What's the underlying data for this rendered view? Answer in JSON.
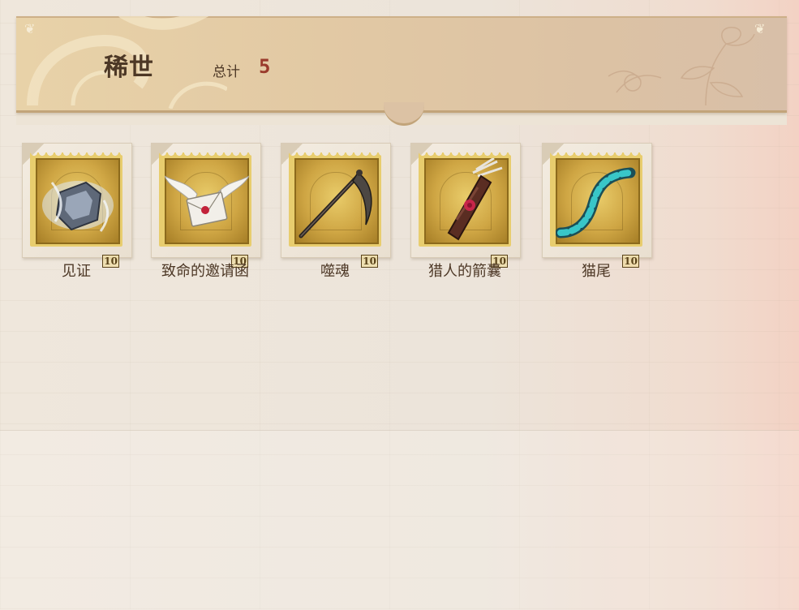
{
  "header": {
    "title": "稀世",
    "total_label": "总计",
    "total_count": "5"
  },
  "items": [
    {
      "label": "见证",
      "icon": "relic-shard-icon",
      "stamp_value": "10"
    },
    {
      "label": "致命的邀请函",
      "icon": "winged-letter-icon",
      "stamp_value": "10"
    },
    {
      "label": "噬魂",
      "icon": "scythe-icon",
      "stamp_value": "10"
    },
    {
      "label": "猎人的箭囊",
      "icon": "quiver-icon",
      "stamp_value": "10"
    },
    {
      "label": "猫尾",
      "icon": "cat-tail-icon",
      "stamp_value": "10"
    }
  ],
  "colors": {
    "header_bg": "#e2c9a4",
    "title_text": "#4d3826",
    "count_text": "#9a3b2c",
    "stamp_gold": "#cfa644"
  }
}
